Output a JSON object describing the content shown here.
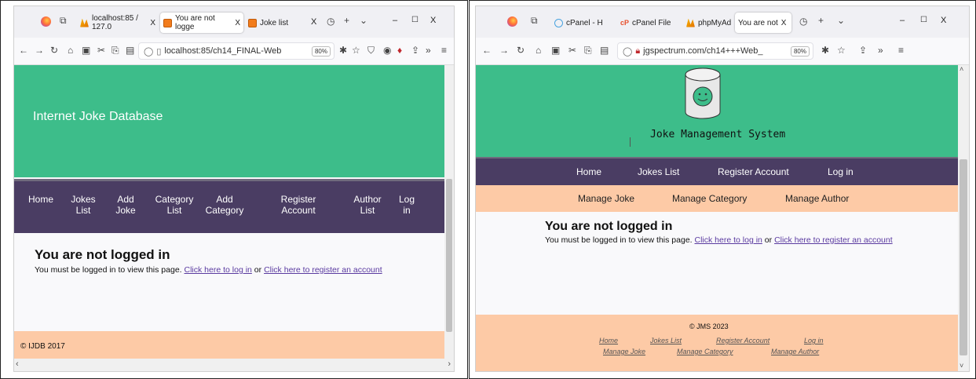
{
  "left": {
    "tabs": [
      {
        "label": "localhost:85 / 127.0",
        "icon": "xampp-icon",
        "close": "X"
      },
      {
        "label": "You are not logge",
        "icon": "page-icon",
        "close": "X"
      },
      {
        "label": "Joke list",
        "icon": "page-icon",
        "close": "X"
      }
    ],
    "url": "localhost:85/ch14_FINAL-Web",
    "zoom": "80%",
    "site_title": "Internet Joke Database",
    "nav": [
      {
        "line1": "Home",
        "line2": ""
      },
      {
        "line1": "Jokes",
        "line2": "List"
      },
      {
        "line1": "Add",
        "line2": "Joke"
      },
      {
        "line1": "Category",
        "line2": "List"
      },
      {
        "line1": "Add",
        "line2": "Category"
      },
      {
        "line1": "Register",
        "line2": "Account"
      },
      {
        "line1": "Author",
        "line2": "List"
      },
      {
        "line1": "Log",
        "line2": "in"
      }
    ],
    "heading": "You are not logged in",
    "message_prefix": "You must be logged in to view this page.",
    "login_link": "Click here to log in",
    "or_text": "or",
    "register_link": "Click here to register an account",
    "footer": "© IJDB 2017"
  },
  "right": {
    "tabs": [
      {
        "label": "cPanel - H",
        "icon": "cpanel-icon"
      },
      {
        "label": "cPanel File",
        "icon": "cp-icon"
      },
      {
        "label": "phpMyAd",
        "icon": "xampp-icon"
      },
      {
        "label": "You are not",
        "icon": "page-icon",
        "close": "X"
      }
    ],
    "url": "jgspectrum.com/ch14+++Web_",
    "zoom": "80%",
    "site_title": "Joke Management System",
    "nav": [
      "Home",
      "Jokes List",
      "Register Account",
      "Log in"
    ],
    "subnav": [
      "Manage Joke",
      "Manage Category",
      "Manage Author"
    ],
    "heading": "You are not logged in",
    "message_prefix": "You must be logged in to view this page.",
    "login_link": "Click here to log in",
    "or_text": "or",
    "register_link": "Click here to register an account",
    "footer_copyright": "© JMS 2023",
    "footer_links_row1": [
      "Home",
      "Jokes List",
      "Register Account",
      "Log in"
    ],
    "footer_links_row2": [
      "Manage Joke",
      "Manage Category",
      "Manage Author"
    ]
  },
  "window": {
    "minimize": "–",
    "maximize": "☐",
    "close": "X"
  },
  "colors": {
    "header_green": "#3dbd8a",
    "nav_purple": "#4a3d63",
    "footer_peach": "#fdcaa6",
    "link_purple": "#5a3aa0"
  }
}
